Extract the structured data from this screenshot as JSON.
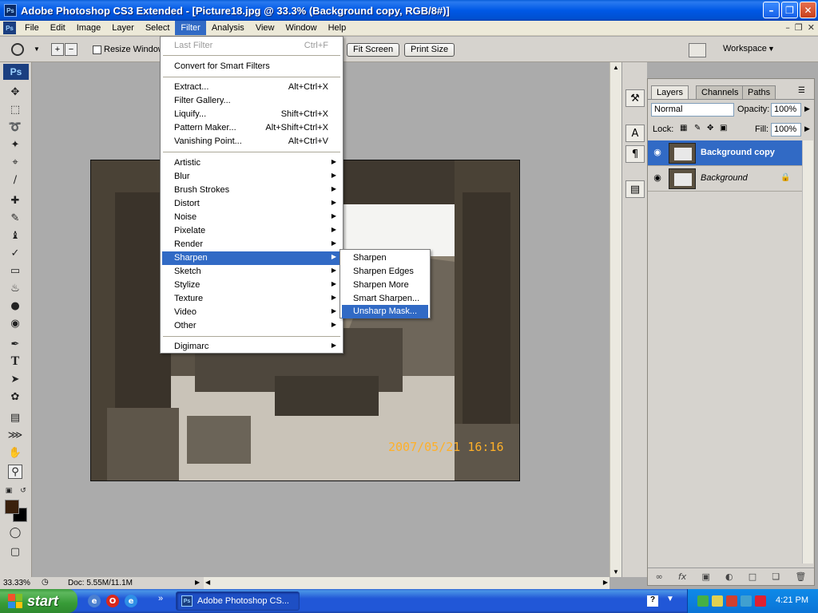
{
  "window": {
    "app_icon": "Ps",
    "title": "Adobe Photoshop CS3 Extended - [Picture18.jpg @ 33.3% (Background copy, RGB/8#)]",
    "controls": [
      "minimize-icon",
      "restore-icon",
      "close-icon"
    ]
  },
  "menubar": {
    "items": [
      "File",
      "Edit",
      "Image",
      "Layer",
      "Select",
      "Filter",
      "Analysis",
      "View",
      "Window",
      "Help"
    ],
    "active": "Filter"
  },
  "options_bar": {
    "resize_windows_label": "Resize Windows",
    "fit_screen_label": "Fit Screen",
    "print_size_label": "Print Size",
    "workspace_label": "Workspace"
  },
  "filter_menu": {
    "last_filter": {
      "label": "Last Filter",
      "shortcut": "Ctrl+F"
    },
    "convert_smart": "Convert for Smart Filters",
    "extract": {
      "label": "Extract...",
      "shortcut": "Alt+Ctrl+X"
    },
    "filter_gallery": "Filter Gallery...",
    "liquify": {
      "label": "Liquify...",
      "shortcut": "Shift+Ctrl+X"
    },
    "pattern_maker": {
      "label": "Pattern Maker...",
      "shortcut": "Alt+Shift+Ctrl+X"
    },
    "vanishing_point": {
      "label": "Vanishing Point...",
      "shortcut": "Alt+Ctrl+V"
    },
    "categories": [
      "Artistic",
      "Blur",
      "Brush Strokes",
      "Distort",
      "Noise",
      "Pixelate",
      "Render",
      "Sharpen",
      "Sketch",
      "Stylize",
      "Texture",
      "Video",
      "Other"
    ],
    "highlighted": "Sharpen",
    "digimarc": "Digimarc"
  },
  "sharpen_submenu": {
    "items": [
      "Sharpen",
      "Sharpen Edges",
      "Sharpen More",
      "Smart Sharpen...",
      "Unsharp Mask..."
    ],
    "highlighted": "Unsharp Mask..."
  },
  "photo": {
    "date_stamp": "2007/05/21  16:16"
  },
  "status_bar": {
    "zoom": "33.33%",
    "doc_info": "Doc: 5.55M/11.1M"
  },
  "tools": {
    "badge": "Ps"
  },
  "layers_panel": {
    "tabs": [
      "Layers",
      "Channels",
      "Paths"
    ],
    "active_tab": "Layers",
    "blend_mode": "Normal",
    "opacity_label": "Opacity:",
    "opacity_value": "100%",
    "lock_label": "Lock:",
    "fill_label": "Fill:",
    "fill_value": "100%",
    "layers": [
      {
        "name": "Background copy",
        "selected": true
      },
      {
        "name": "Background",
        "selected": false,
        "locked": true
      }
    ]
  },
  "taskbar": {
    "start_label": "start",
    "task_item": "Adobe Photoshop CS...",
    "clock": "4:21 PM"
  }
}
